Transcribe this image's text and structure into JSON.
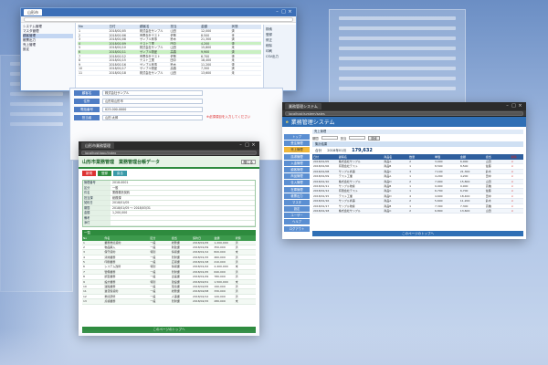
{
  "window_list": {
    "tab_title": "山形市",
    "tree_items": [
      "システム管理",
      "マスタ管理",
      "顧客管理",
      "帳票出力",
      "売上管理",
      "設定"
    ],
    "columns": [
      "No",
      "日付",
      "顧客名",
      "担当",
      "金額",
      "状態"
    ],
    "rows": [
      [
        "1",
        "2018/01/05",
        "株式会社サンプル",
        "山田",
        "12,000",
        "済"
      ],
      [
        "2",
        "2018/01/06",
        "有限会社テスト",
        "佐藤",
        "8,500",
        "未"
      ],
      [
        "3",
        "2018/01/08",
        "サンプル商事",
        "鈴木",
        "21,300",
        "済"
      ],
      [
        "4",
        "2018/01/09",
        "テスト工業",
        "田中",
        "4,200",
        "済"
      ],
      [
        "5",
        "2018/01/10",
        "株式会社サンプル",
        "山田",
        "15,800",
        "未"
      ],
      [
        "6",
        "2018/01/11",
        "サンプル物産",
        "高橋",
        "9,900",
        "済"
      ],
      [
        "7",
        "2018/01/12",
        "有限会社テスト",
        "佐藤",
        "6,700",
        "済"
      ],
      [
        "8",
        "2018/01/15",
        "テスト工業",
        "田中",
        "18,400",
        "未"
      ],
      [
        "9",
        "2018/01/16",
        "サンプル商事",
        "鈴木",
        "11,200",
        "済"
      ],
      [
        "10",
        "2018/01/17",
        "サンプル物産",
        "高橋",
        "7,300",
        "済"
      ],
      [
        "11",
        "2018/01/18",
        "株式会社サンプル",
        "山田",
        "13,600",
        "未"
      ]
    ],
    "side_items": [
      "検索",
      "登録",
      "修正",
      "削除",
      "印刷",
      "CSV出力"
    ]
  },
  "window_form": {
    "fields": [
      {
        "label": "顧客名",
        "value": "株式会社サンプル"
      },
      {
        "label": "住所",
        "value": "山形県山形市"
      },
      {
        "label": "電話番号",
        "value": "023-000-0000"
      },
      {
        "label": "担当者",
        "value": "山田 太郎"
      }
    ],
    "warning": "※必須項目を入力してください"
  },
  "window_green": {
    "tab_title": "山形市業務管理",
    "url": "localhost/app/index",
    "title": "山形市業務管理　業務管理台帳データ",
    "close_label": "閉じる",
    "buttons": [
      "新規",
      "登録",
      "戻る"
    ],
    "form_rows": [
      {
        "label": "管理番号",
        "value": "2018-0001"
      },
      {
        "label": "区分",
        "value": "一般"
      },
      {
        "label": "件名",
        "value": "業務委託契約"
      },
      {
        "label": "担当課",
        "value": "総務課"
      },
      {
        "label": "契約日",
        "value": "2018/01/05"
      },
      {
        "label": "期間",
        "value": "2018/01/05 ～ 2018/03/31"
      },
      {
        "label": "金額",
        "value": "1,200,000"
      },
      {
        "label": "備考",
        "value": ""
      },
      {
        "label": "添付",
        "value": ""
      }
    ],
    "list_title": "一覧",
    "columns": [
      "No",
      "件名",
      "区分",
      "担当",
      "契約日",
      "金額",
      "状態"
    ],
    "rows": [
      [
        "1",
        "業務委託契約",
        "一般",
        "総務課",
        "2018/01/05",
        "1,200,000",
        "済"
      ],
      [
        "2",
        "物品購入",
        "一般",
        "財政課",
        "2018/01/09",
        "350,000",
        "済"
      ],
      [
        "3",
        "保守契約",
        "特別",
        "情報課",
        "2018/01/12",
        "820,000",
        "未"
      ],
      [
        "4",
        "清掃業務",
        "一般",
        "管財課",
        "2018/01/15",
        "460,000",
        "済"
      ],
      [
        "5",
        "印刷業務",
        "一般",
        "広報課",
        "2018/01/18",
        "210,000",
        "済"
      ],
      [
        "6",
        "システム改修",
        "特別",
        "情報課",
        "2018/01/22",
        "2,400,000",
        "未"
      ],
      [
        "7",
        "警備業務",
        "一般",
        "管財課",
        "2018/01/25",
        "640,000",
        "済"
      ],
      [
        "8",
        "調査業務",
        "一般",
        "企画課",
        "2018/01/29",
        "780,000",
        "済"
      ],
      [
        "9",
        "設計業務",
        "特別",
        "建設課",
        "2018/02/01",
        "1,500,000",
        "未"
      ],
      [
        "10",
        "運搬業務",
        "一般",
        "環境課",
        "2018/02/05",
        "190,000",
        "済"
      ],
      [
        "11",
        "賃貸借契約",
        "一般",
        "総務課",
        "2018/02/08",
        "330,000",
        "済"
      ],
      [
        "12",
        "委託研修",
        "一般",
        "人事課",
        "2018/02/12",
        "120,000",
        "済"
      ],
      [
        "13",
        "点検業務",
        "一般",
        "管財課",
        "2018/02/15",
        "280,000",
        "未"
      ]
    ],
    "footer": "このページのトップへ"
  },
  "window_blue": {
    "tab_title": "業務管理システム",
    "url": "localhost/system/sales",
    "logo": "e",
    "app_title": "業務管理システム",
    "nav_items": [
      "トップ",
      "受注管理",
      "売上管理",
      "請求管理",
      "入金管理",
      "顧客管理",
      "商品管理",
      "仕入管理",
      "在庫管理",
      "帳票出力",
      "マスタ",
      "設定",
      "ユーザー",
      "ヘルプ",
      "ログアウト"
    ],
    "active_nav": 2,
    "crumb": "売上管理",
    "filter": {
      "period_label": "期間",
      "staff_label": "担当",
      "search_label": "検索"
    },
    "summary_text": "集計結果",
    "total_label": "合計",
    "total_period": "2018年01月",
    "total_amount": "179,632",
    "columns": [
      "日付",
      "顧客名",
      "商品名",
      "数量",
      "単価",
      "金額",
      "担当",
      "削除"
    ],
    "rows": [
      [
        "2018/01/05",
        "株式会社サンプル",
        "商品A",
        "2",
        "3,000",
        "6,000",
        "山田",
        "×"
      ],
      [
        "2018/01/06",
        "有限会社テスト",
        "商品B",
        "1",
        "8,500",
        "8,500",
        "佐藤",
        "×"
      ],
      [
        "2018/01/08",
        "サンプル商事",
        "商品C",
        "3",
        "7,100",
        "21,300",
        "鈴木",
        "×"
      ],
      [
        "2018/01/09",
        "テスト工業",
        "商品A",
        "1",
        "4,200",
        "4,200",
        "田中",
        "×"
      ],
      [
        "2018/01/10",
        "株式会社サンプル",
        "商品D",
        "2",
        "7,900",
        "15,800",
        "山田",
        "×"
      ],
      [
        "2018/01/11",
        "サンプル物産",
        "商品B",
        "1",
        "9,900",
        "9,900",
        "高橋",
        "×"
      ],
      [
        "2018/01/12",
        "有限会社テスト",
        "商品C",
        "1",
        "6,700",
        "6,700",
        "佐藤",
        "×"
      ],
      [
        "2018/01/15",
        "テスト工業",
        "商品D",
        "4",
        "4,600",
        "18,400",
        "田中",
        "×"
      ],
      [
        "2018/01/16",
        "サンプル商事",
        "商品A",
        "2",
        "5,600",
        "11,200",
        "鈴木",
        "×"
      ],
      [
        "2018/01/17",
        "サンプル物産",
        "商品B",
        "1",
        "7,300",
        "7,300",
        "高橋",
        "×"
      ],
      [
        "2018/01/18",
        "株式会社サンプル",
        "商品C",
        "2",
        "6,800",
        "13,600",
        "山田",
        "×"
      ]
    ],
    "footer": "このページのトップへ"
  }
}
